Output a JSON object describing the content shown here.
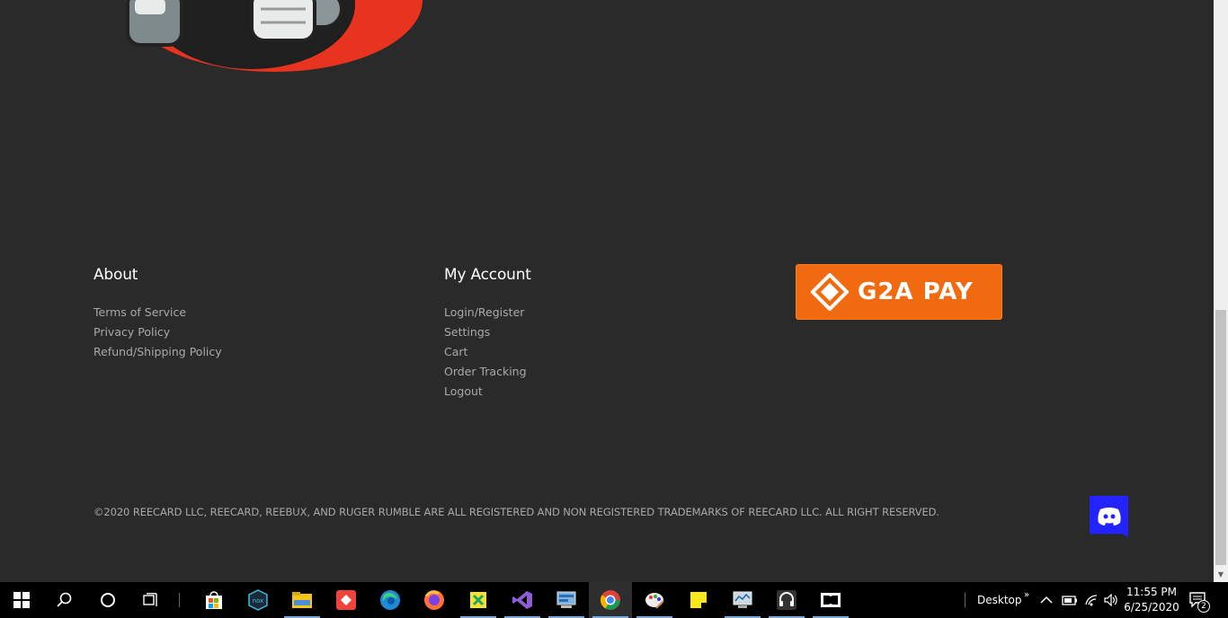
{
  "footer": {
    "about": {
      "heading": "About",
      "links": [
        "Terms of Service",
        "Privacy Policy",
        "Refund/Shipping Policy"
      ]
    },
    "account": {
      "heading": "My Account",
      "links": [
        "Login/Register",
        "Settings",
        "Cart",
        "Order Tracking",
        "Logout"
      ]
    },
    "g2a_label": "G2A PAY",
    "copyright": "©2020 REECARD LLC, REECARD, REEBUX, AND RUGER RUMBLE ARE ALL REGISTERED AND NON REGISTERED TRADEMARKS OF REECARD LLC. ALL RIGHT RESERVED."
  },
  "taskbar": {
    "apps": [
      "windows-start",
      "search",
      "cortana",
      "task-view",
      "microsoft-store",
      "nox",
      "file-explorer",
      "anydesk",
      "edge",
      "firefox",
      "excel",
      "visual-studio",
      "control-panel",
      "chrome",
      "paint",
      "sticky-notes",
      "network-app",
      "headset-app",
      "dolby"
    ],
    "desktop_label": "Desktop",
    "time": "11:55 PM",
    "date": "6/25/2020",
    "notification_count": "2"
  },
  "colors": {
    "background": "#2b2a2b",
    "g2a_orange": "#f26a10",
    "discord_blue": "#2323ff"
  }
}
